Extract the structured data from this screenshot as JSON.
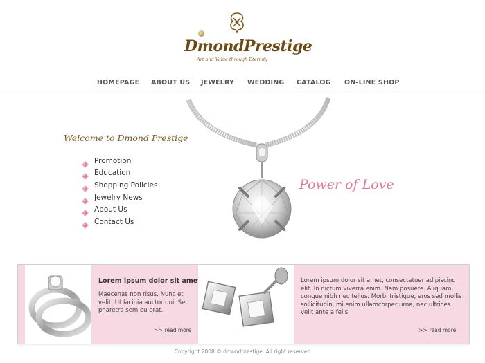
{
  "brand": {
    "name": "DmondPrestige",
    "tagline": "Art and Value through Eternity"
  },
  "nav": {
    "items": [
      {
        "label": "HOMEPAGE"
      },
      {
        "label": "ABOUT US"
      },
      {
        "label": "JEWELRY"
      },
      {
        "label": "WEDDING"
      },
      {
        "label": "CATALOG"
      },
      {
        "label": "ON-LINE SHOP"
      }
    ]
  },
  "hero": {
    "welcome": "Welcome to Dmond Prestige",
    "slogan": "Power of Love",
    "menu": [
      {
        "label": "Promotion"
      },
      {
        "label": "Education"
      },
      {
        "label": "Shopping Policies"
      },
      {
        "label": "Jewelry News"
      },
      {
        "label": "About Us"
      },
      {
        "label": "Contact Us"
      }
    ]
  },
  "features": {
    "left": {
      "title": "Lorem ipsum dolor sit amet",
      "text": "Maecenas non risus. Nunc et velit. Ut lacinia auctor dui. Sed pharetra sem eu erat.",
      "more_arrows": ">>",
      "more_label": "read more"
    },
    "right": {
      "text": "Lorem ipsum dolor sit amet, consectetuer adipiscing elit. In dictum viverra enim. Nam posuere. Aliquam congue nibh nec tellus. Morbi tristique, eros sed mollis sollicitudin, mi enim ullamcorper urna, nec ultrices velit ante a felis.",
      "more_arrows": ">>",
      "more_label": "read more"
    }
  },
  "footer": {
    "copyright": "Copyright 2008 © dmondprestige. All right reserved"
  },
  "colors": {
    "brand_gold": "#7a5a1e",
    "accent_pink": "#e07a9a",
    "panel_pink": "#f6d9e2",
    "nav_text": "#555555"
  }
}
